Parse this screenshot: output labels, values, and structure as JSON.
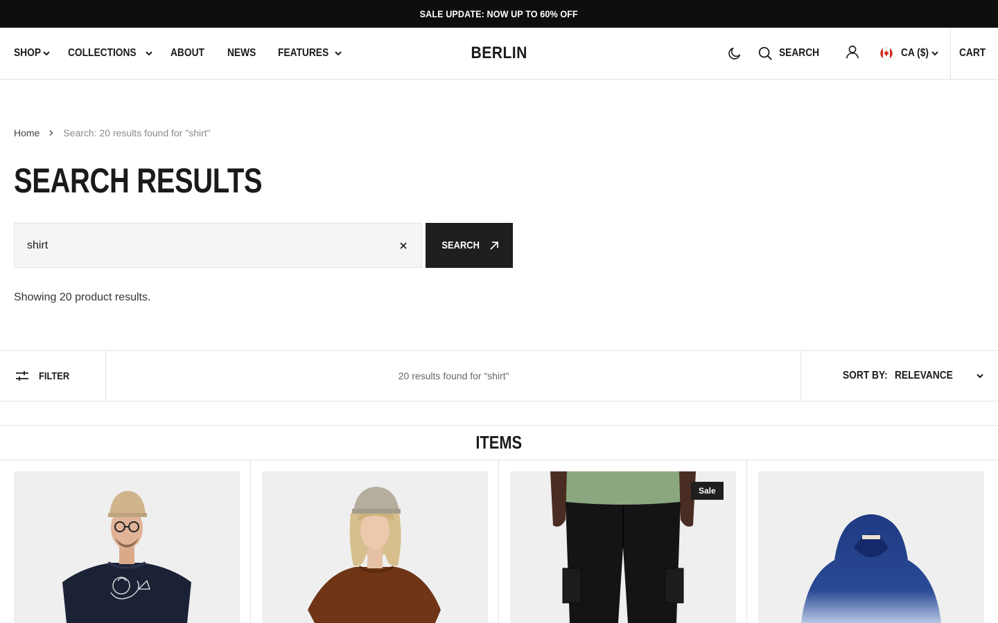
{
  "announcement": "SALE UPDATE: NOW UP TO 60% OFF",
  "nav": {
    "shop": "SHOP",
    "collections": "COLLECTIONS",
    "about": "ABOUT",
    "news": "NEWS",
    "features": "FEATURES"
  },
  "logo": "BERLIN",
  "header_right": {
    "search_label": "SEARCH",
    "currency": "CA ($)",
    "cart_label": "CART"
  },
  "breadcrumb": {
    "home": "Home",
    "current": "Search: 20 results found for \"shirt\""
  },
  "page_title": "SEARCH RESULTS",
  "search_form": {
    "query": "shirt",
    "submit_label": "SEARCH"
  },
  "results_note": "Showing 20 product results.",
  "toolbar": {
    "filter_label": "FILTER",
    "result_count": "20 results found for “shirt”",
    "sort_label": "SORT BY:",
    "sort_value": "RELEVANCE"
  },
  "items_heading": "ITEMS",
  "products": [
    {
      "image": "man-navy-graphic-tee",
      "badge": ""
    },
    {
      "image": "woman-brown-tee",
      "badge": ""
    },
    {
      "image": "green-tee-black-cargo-pants",
      "badge": "Sale"
    },
    {
      "image": "blue-gradient-hoodie",
      "badge": ""
    }
  ],
  "colors": {
    "announcement_bg": "#0e0e0e",
    "button_dark": "#1f1f1f",
    "border": "#e2e2e2",
    "card_bg": "#efefef"
  }
}
